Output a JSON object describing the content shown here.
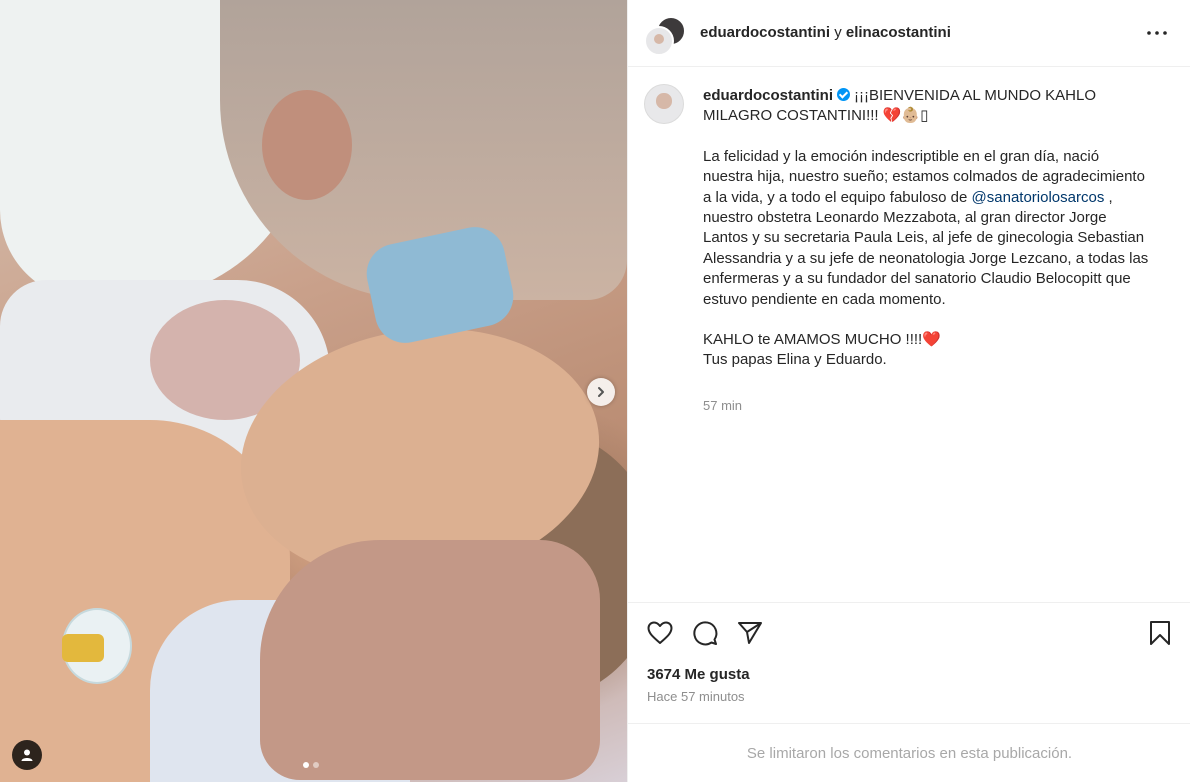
{
  "header": {
    "user1": "eduardocostantini",
    "conj": "y",
    "user2": "elinacostantini"
  },
  "caption": {
    "username": "eduardocostantini",
    "title": "¡¡¡BIENVENIDA AL MUNDO KAHLO MILAGRO COSTANTINI!!! 💔👶🏼▯",
    "p1_before": "La felicidad y la emoción indescriptible en el gran día, nació nuestra hija, nuestro sueño; estamos colmados de agradecimiento a la vida, y a todo el equipo fabuloso de ",
    "p1_mention": "@sanatoriolosarcos",
    "p1_after": " , nuestro obstetra Leonardo Mezzabota, al gran director Jorge Lantos y su secretaria Paula Leis, al jefe de ginecologia Sebastian Alessandria y a su jefe de neonatologia Jorge Lezcano, a todas las enfermeras y a su fundador del sanatorio Claudio Belocopitt que estuvo pendiente en cada momento.",
    "p2_line1": "KAHLO te AMAMOS MUCHO !!!!",
    "p2_heart": "❤️",
    "p2_line2": "Tus papas Elina y Eduardo.",
    "time": "57 min"
  },
  "stats": {
    "likes": "3674 Me gusta",
    "ago": "Hace 57 minutos"
  },
  "footer": {
    "comments_disabled": "Se limitaron los comentarios en esta publicación."
  },
  "carousel": {
    "slides": 2,
    "current": 1
  },
  "colors": {
    "verified": "#0095f6",
    "mention": "#00376b",
    "muted": "#8e8e8e"
  }
}
